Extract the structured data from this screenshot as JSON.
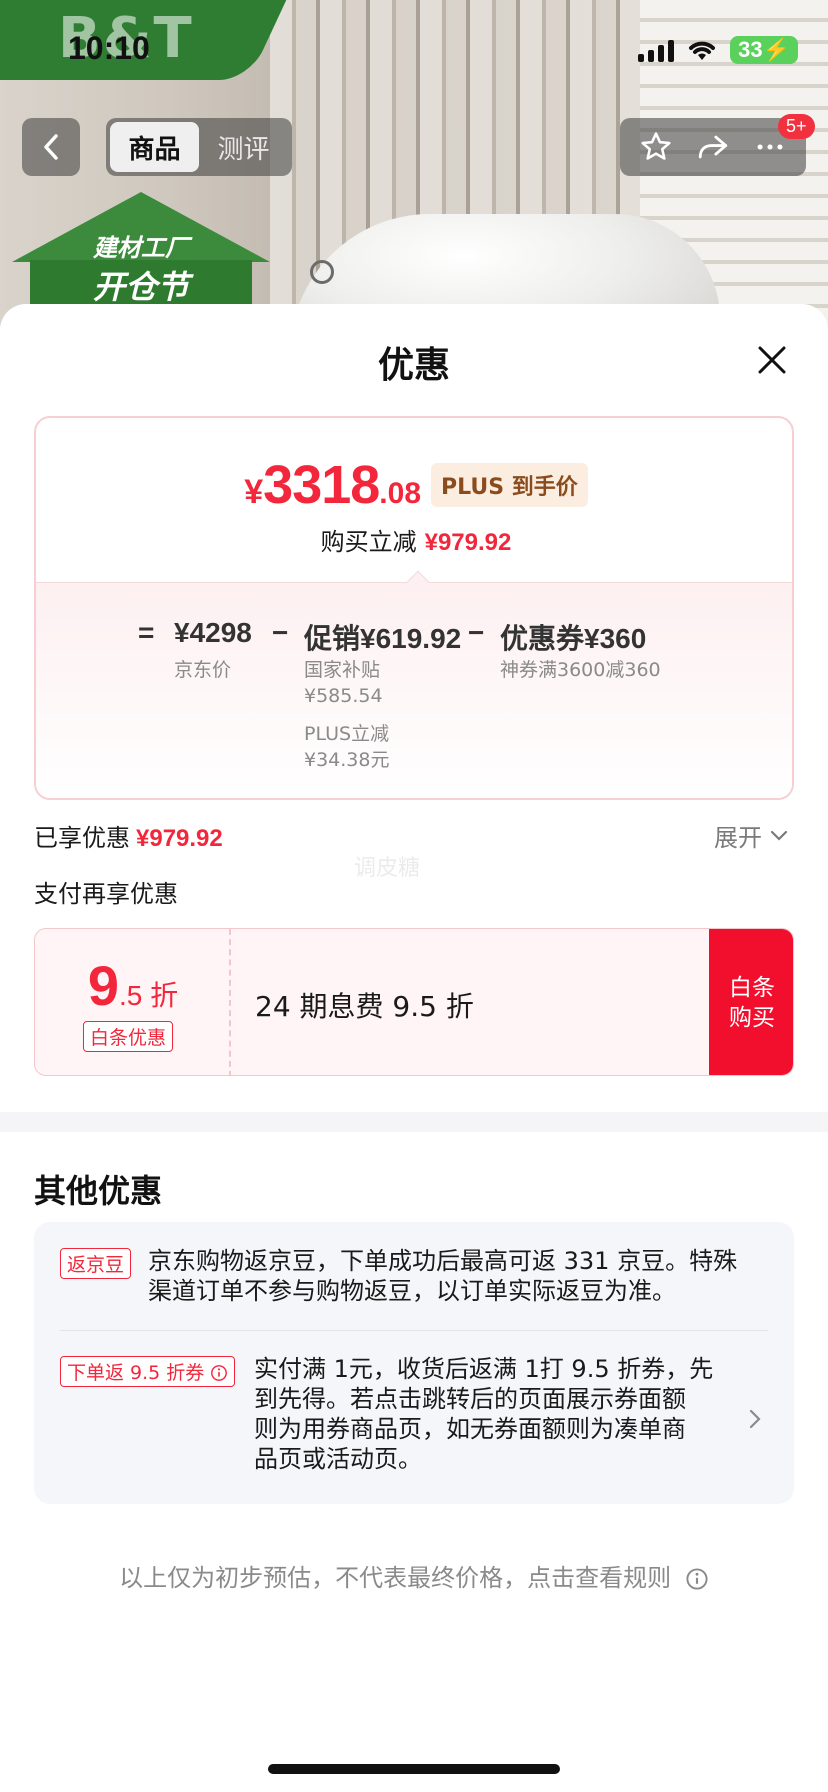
{
  "status_bar": {
    "time": "10:10",
    "battery": "33"
  },
  "background": {
    "brand": "B&T",
    "promo_line1": "建材工厂",
    "promo_line2": "开仓节"
  },
  "nav": {
    "tabs": [
      {
        "label": "商品",
        "active": true
      },
      {
        "label": "测评",
        "active": false
      }
    ],
    "badge": "5+"
  },
  "sheet": {
    "title": "优惠",
    "price": {
      "yen": "¥",
      "integer": "3318",
      "decimal": ".08",
      "plus_tag": "PLUS 到手价"
    },
    "reduce": {
      "label": "购买立减",
      "amount": "¥979.92"
    },
    "breakdown": {
      "equals": "=",
      "jd_price": {
        "amount": "¥4298",
        "label": "京东价"
      },
      "minus1": "−",
      "promo": {
        "amount": "促销¥619.92",
        "sub1_label": "国家补贴",
        "sub1_value": "¥585.54",
        "sub2_label": "PLUS立减",
        "sub2_value": "¥34.38元"
      },
      "minus2": "−",
      "coupon": {
        "amount": "优惠券¥360",
        "label": "神券满3600减360"
      }
    },
    "enjoyed": {
      "label": "已享优惠",
      "amount": "¥979.92"
    },
    "expand_label": "展开",
    "watermark": "调皮糖",
    "pay_section_label": "支付再享优惠",
    "pay_card": {
      "disc_big": "9",
      "disc_small": ".5 折",
      "tag": "白条优惠",
      "desc": "24 期息费 9.5 折",
      "button": "白条购买"
    },
    "other_title": "其他优惠",
    "other_items": [
      {
        "tag": "返京豆",
        "text_line1": "京东购物返京豆，下单成功后最高可返 331 京豆。特殊",
        "text_line2": "渠道订单不参与购物返豆，以订单实际返豆为准。"
      },
      {
        "tag": "下单返 9.5 折券",
        "text_line1": "实付满 1元，收货后返满 1打 9.5 折券，先",
        "text_line2": "到先得。若点击跳转后的页面展示券面额",
        "text_line3": "则为用券商品页，如无券面额则为凑单商",
        "text_line4": "品页或活动页。"
      }
    ],
    "footer_note": "以上仅为初步预估，不代表最终价格，点击查看规则"
  },
  "colors": {
    "accent_red": "#f2273c",
    "button_red": "#f20f2e",
    "plus_gold": "#8a4b1d",
    "brand_green": "#2f7d32"
  }
}
